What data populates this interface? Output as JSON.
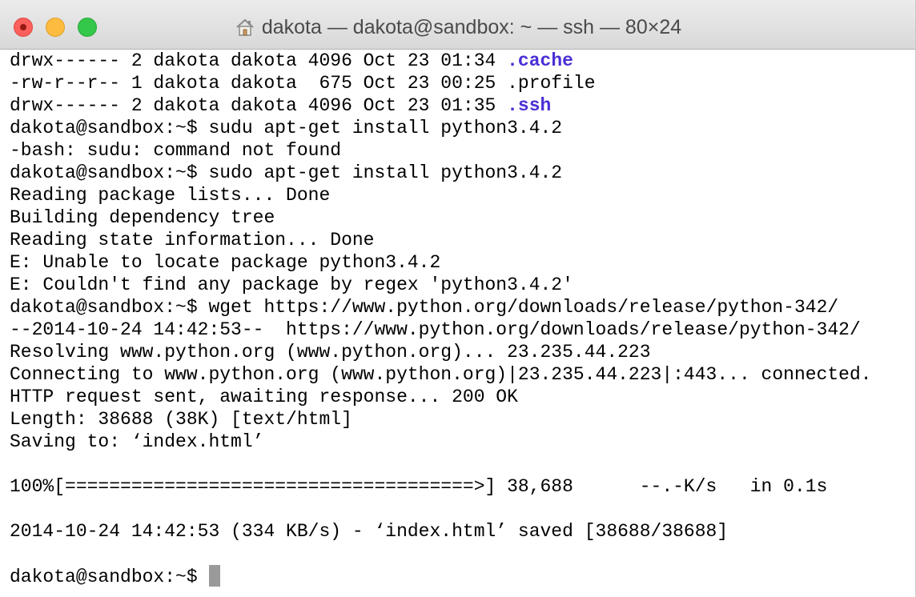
{
  "window": {
    "title": "dakota — dakota@sandbox: ~ — ssh — 80×24",
    "buttons": {
      "close": "close",
      "minimize": "minimize",
      "zoom": "zoom"
    },
    "icon": "home-icon"
  },
  "terminal": {
    "line1": {
      "text": "drwx------ 2 dakota dakota 4096 Oct 23 01:34 ",
      "dir": ".cache"
    },
    "line2": {
      "text": "-rw-r--r-- 1 dakota dakota  675 Oct 23 00:25 .profile"
    },
    "line3": {
      "text": "drwx------ 2 dakota dakota 4096 Oct 23 01:35 ",
      "dir": ".ssh"
    },
    "line4": "dakota@sandbox:~$ sudu apt-get install python3.4.2",
    "line5": "-bash: sudu: command not found",
    "line6": "dakota@sandbox:~$ sudo apt-get install python3.4.2",
    "line7": "Reading package lists... Done",
    "line8": "Building dependency tree",
    "line9": "Reading state information... Done",
    "line10": "E: Unable to locate package python3.4.2",
    "line11": "E: Couldn't find any package by regex 'python3.4.2'",
    "line12": "dakota@sandbox:~$ wget https://www.python.org/downloads/release/python-342/",
    "line13": "--2014-10-24 14:42:53--  https://www.python.org/downloads/release/python-342/",
    "line14": "Resolving www.python.org (www.python.org)... 23.235.44.223",
    "line15": "Connecting to www.python.org (www.python.org)|23.235.44.223|:443... connected.",
    "line16": "HTTP request sent, awaiting response... 200 OK",
    "line17": "Length: 38688 (38K) [text/html]",
    "line18": "Saving to: ‘index.html’",
    "line19": "",
    "line20": "100%[=====================================>] 38,688      --.-K/s   in 0.1s",
    "line21": "",
    "line22": "2014-10-24 14:42:53 (334 KB/s) - ‘index.html’ saved [38688/38688]",
    "line23": "",
    "prompt": "dakota@sandbox:~$ "
  },
  "colors": {
    "directory": "#4b2fd6",
    "cursor": "#9a9a9a",
    "close": "#fc605c",
    "minimize": "#fdbc40",
    "zoom": "#34c84a"
  }
}
